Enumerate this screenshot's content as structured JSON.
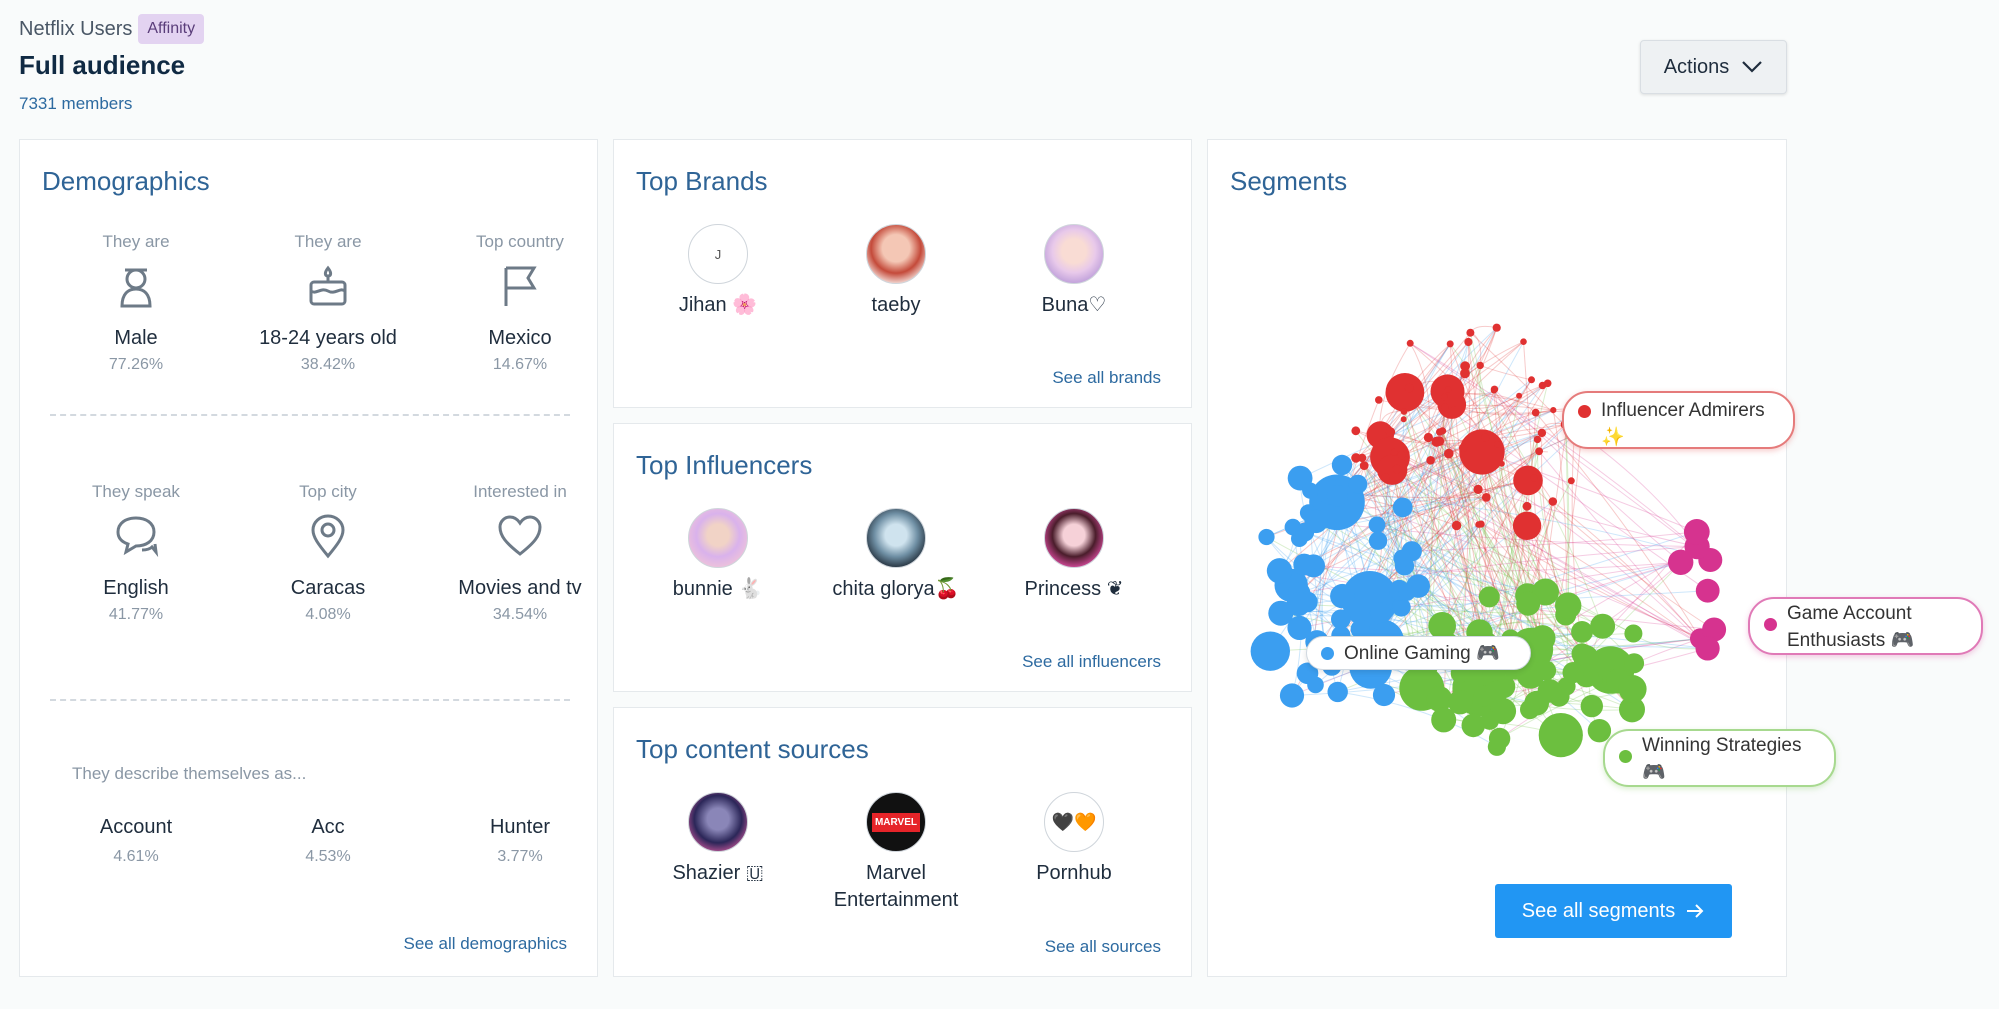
{
  "header": {
    "source": "Netflix Users",
    "badge": "Affinity",
    "title": "Full audience",
    "members": "7331 members",
    "actions_label": "Actions"
  },
  "demographics": {
    "title": "Demographics",
    "items": [
      {
        "caption": "They are",
        "value": "Male",
        "pct": "77.26%",
        "icon": "person-icon"
      },
      {
        "caption": "They are",
        "value": "18-24 years old",
        "pct": "38.42%",
        "icon": "cake-icon"
      },
      {
        "caption": "Top country",
        "value": "Mexico",
        "pct": "14.67%",
        "icon": "flag-icon"
      },
      {
        "caption": "They speak",
        "value": "English",
        "pct": "41.77%",
        "icon": "speech-bubbles-icon"
      },
      {
        "caption": "Top city",
        "value": "Caracas",
        "pct": "4.08%",
        "icon": "map-pin-icon"
      },
      {
        "caption": "Interested in",
        "value": "Movies and tv",
        "pct": "34.54%",
        "icon": "heart-icon"
      }
    ],
    "describe_caption": "They describe themselves as...",
    "describe": [
      {
        "value": "Account",
        "pct": "4.61%"
      },
      {
        "value": "Acc",
        "pct": "4.53%"
      },
      {
        "value": "Hunter",
        "pct": "3.77%"
      }
    ],
    "see_all": "See all demographics"
  },
  "brands": {
    "title": "Top Brands",
    "items": [
      {
        "name": "Jihan 🌸",
        "initial": "J"
      },
      {
        "name": "taeby"
      },
      {
        "name": "Buna♡"
      }
    ],
    "see_all": "See all brands"
  },
  "influencers": {
    "title": "Top Influencers",
    "items": [
      {
        "name": "bunnie 🐇"
      },
      {
        "name": "chita glorya🍒"
      },
      {
        "name": "Princess ❦"
      }
    ],
    "see_all": "See all influencers"
  },
  "sources": {
    "title": "Top content sources",
    "items": [
      {
        "name": "Shazier 🇺"
      },
      {
        "name": "Marvel Entertainment",
        "logo_text": "MARVEL"
      },
      {
        "name": "Pornhub",
        "logo_text": "🖤🧡"
      }
    ],
    "see_all": "See all sources"
  },
  "segments": {
    "title": "Segments",
    "labels": [
      {
        "text": "Influencer Admirers ✨",
        "color": "#e03131"
      },
      {
        "text": "Game Account Enthusiasts 🎮",
        "color": "#d6338f"
      },
      {
        "text": "Online Gaming 🎮",
        "color": "#3b9ef0"
      },
      {
        "text": "Winning Strategies 🎮",
        "color": "#6cbf3f"
      }
    ],
    "button_label": "See all segments"
  },
  "colors": {
    "accent": "#2196f3",
    "title_blue": "#2f6496",
    "red": "#e03131",
    "pink": "#d6338f",
    "blue": "#3b9ef0",
    "green": "#6cbf3f"
  }
}
